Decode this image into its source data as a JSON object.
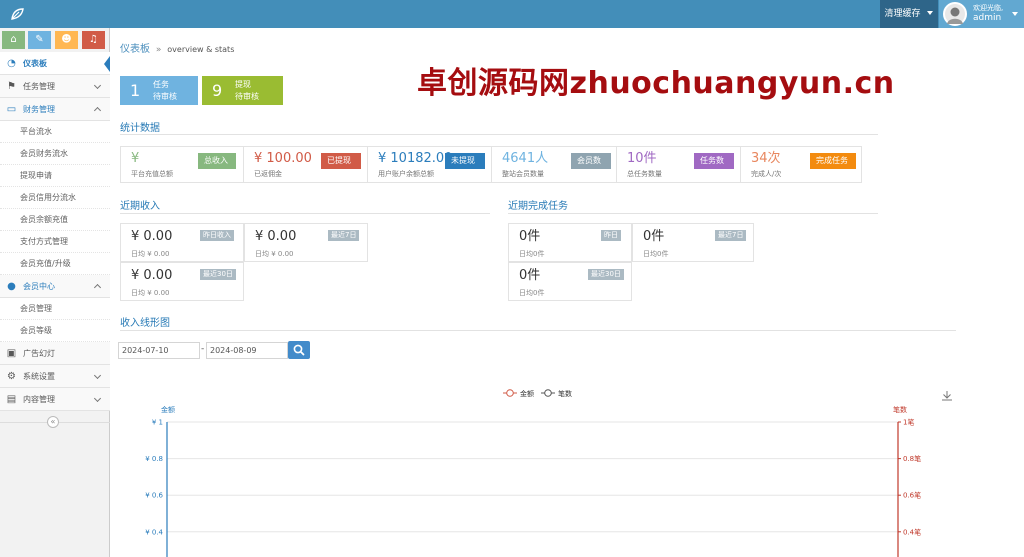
{
  "topbar": {
    "clear_cache": "清理缓存",
    "welcome": "欢迎光临,",
    "username": "admin"
  },
  "sidebar": {
    "shortcuts": [
      {
        "icon": "home-icon",
        "color": "#87b87f",
        "glyph": "⌂"
      },
      {
        "icon": "pencil-icon",
        "color": "#6fb3e0",
        "glyph": "✎"
      },
      {
        "icon": "users-icon",
        "color": "#ffb752",
        "glyph": "☻"
      },
      {
        "icon": "bell-icon",
        "color": "#d15b47",
        "glyph": "♫"
      }
    ],
    "items": [
      {
        "label": "仪表板",
        "icon": "dashboard-icon"
      },
      {
        "label": "任务管理",
        "icon": "flag-icon"
      },
      {
        "label": "财务管理",
        "icon": "wallet-icon"
      },
      {
        "label": "会员中心",
        "icon": "user-icon"
      },
      {
        "label": "广告幻灯",
        "icon": "picture-icon"
      },
      {
        "label": "系统设置",
        "icon": "gear-icon"
      },
      {
        "label": "内容管理",
        "icon": "book-icon"
      }
    ],
    "finance_sub": [
      "平台流水",
      "会员财务流水",
      "提现申请",
      "会员信用分流水",
      "会员余额充值",
      "支付方式管理",
      "会员充值/升级"
    ],
    "member_sub": [
      "会员管理",
      "会员等级"
    ],
    "collapse_glyph": "«"
  },
  "breadcrumb": {
    "home": "仪表板",
    "separator": "»",
    "current": "overview & stats"
  },
  "tiles": [
    {
      "num": "1",
      "line1": "任务",
      "line2": "待审核",
      "color": "#6fb3e0"
    },
    {
      "num": "9",
      "line1": "提现",
      "line2": "待审核",
      "color": "#9abc32"
    }
  ],
  "watermark": "卓创源码网zhuochuangyun.cn",
  "stats": {
    "title": "统计数据",
    "items": [
      {
        "value": "¥",
        "caption": "平台充值总额",
        "tag": "总收入",
        "color": "#87b87f",
        "tag_color": "#87b87f"
      },
      {
        "value": "¥ 100.00",
        "caption": "已返佣金",
        "tag": "已提现",
        "color": "#d15b47",
        "tag_color": "#d15b47"
      },
      {
        "value": "¥ 10182.00",
        "caption": "用户账户余额总额",
        "tag": "未提现",
        "color": "#2b7dbc",
        "tag_color": "#2b7dbc"
      },
      {
        "value": "4641人",
        "caption": "整站会员数量",
        "tag": "会员数",
        "color": "#6fb3e0",
        "tag_color": "#8fa4b0"
      },
      {
        "value": "10件",
        "caption": "总任务数量",
        "tag": "任务数",
        "color": "#a069c3",
        "tag_color": "#a069c3"
      },
      {
        "value": "34次",
        "caption": "完成人/次",
        "tag": "完成任务",
        "color": "#e8875f",
        "tag_color": "#f38b0f"
      }
    ]
  },
  "income": {
    "title": "近期收入",
    "boxes": [
      {
        "amount": "¥ 0.00",
        "sub": "日均 ¥ 0.00",
        "tag": "昨日收入"
      },
      {
        "amount": "¥ 0.00",
        "sub": "日均 ¥ 0.00",
        "tag": "最近7日"
      },
      {
        "amount": "¥ 0.00",
        "sub": "日均 ¥ 0.00",
        "tag": "最近30日"
      }
    ]
  },
  "tasks": {
    "title": "近期完成任务",
    "boxes": [
      {
        "amount": "0件",
        "sub": "日均0件",
        "tag": "昨日"
      },
      {
        "amount": "0件",
        "sub": "日均0件",
        "tag": "最近7日"
      },
      {
        "amount": "0件",
        "sub": "日均0件",
        "tag": "最近30日"
      }
    ]
  },
  "line_section": {
    "title": "收入线形图",
    "date_from": "2024-07-10",
    "date_to": "2024-08-09",
    "dash": "-"
  },
  "chart_data": {
    "type": "line",
    "series": [
      {
        "name": "金额",
        "color": "#d15b47",
        "values": []
      },
      {
        "name": "笔数",
        "color": "#555555",
        "values": []
      }
    ],
    "left_axis": {
      "label": "金额",
      "ticks": [
        "¥ 1",
        "¥ 0.8",
        "¥ 0.6",
        "¥ 0.4",
        "¥ 0.2"
      ],
      "color": "#2b7dbc"
    },
    "right_axis": {
      "label": "笔数",
      "ticks": [
        "1笔",
        "0.8笔",
        "0.6笔",
        "0.4笔",
        "0.2笔"
      ],
      "color": "#c0392b"
    },
    "ylim": [
      0,
      1
    ],
    "grid": true,
    "legend": "top-center"
  }
}
